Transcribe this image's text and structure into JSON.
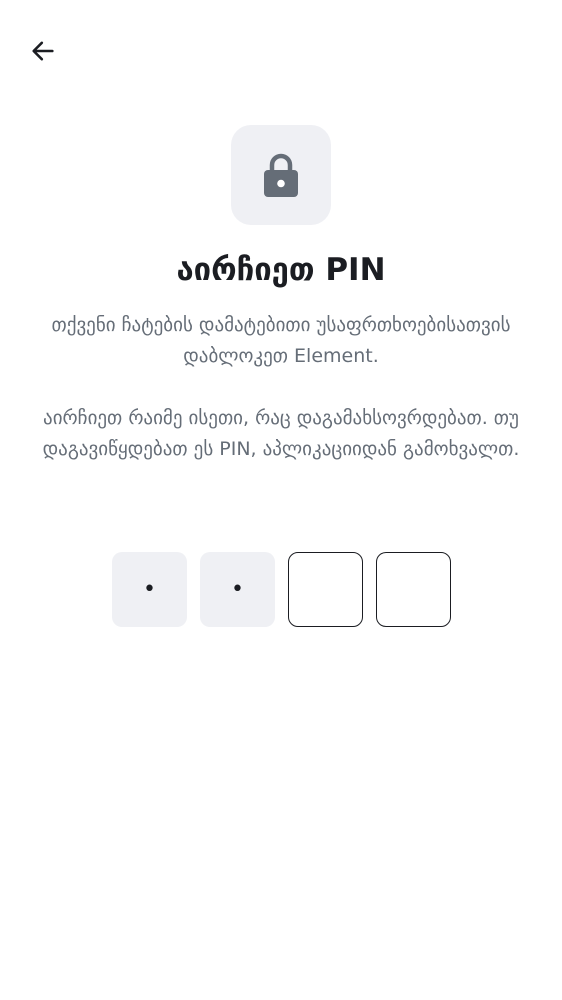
{
  "header": {
    "back_icon": "arrow-left-icon"
  },
  "hero": {
    "icon": "lock-icon",
    "title": "აირჩიეთ PIN",
    "description_1": "თქვენი ჩატების დამატებითი უსაფრთხოებისათვის დაბლოკეთ Element.",
    "description_2": "აირჩიეთ რაიმე ისეთი, რაც დაგამახსოვრდებათ. თუ დაგავიწყდებათ ეს PIN, აპლიკაციიდან გამოხვალთ."
  },
  "pin": {
    "length": 4,
    "entered_count": 2,
    "cells": [
      "•",
      "•",
      "",
      ""
    ]
  },
  "colors": {
    "tile_background": "#eff0f4",
    "text_primary": "#1b1d22",
    "text_secondary": "#656d77"
  }
}
